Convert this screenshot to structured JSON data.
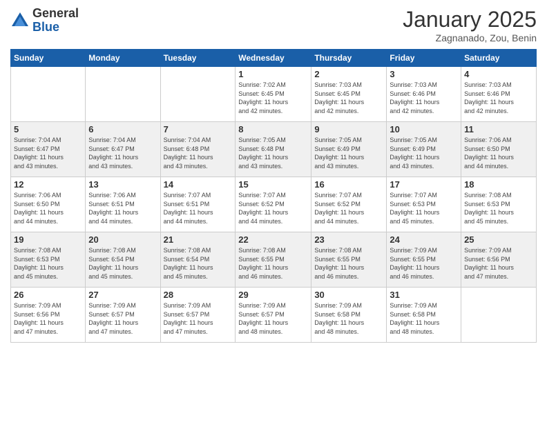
{
  "logo": {
    "general": "General",
    "blue": "Blue"
  },
  "header": {
    "title": "January 2025",
    "subtitle": "Zagnanado, Zou, Benin"
  },
  "days_of_week": [
    "Sunday",
    "Monday",
    "Tuesday",
    "Wednesday",
    "Thursday",
    "Friday",
    "Saturday"
  ],
  "weeks": [
    [
      {
        "day": "",
        "info": ""
      },
      {
        "day": "",
        "info": ""
      },
      {
        "day": "",
        "info": ""
      },
      {
        "day": "1",
        "info": "Sunrise: 7:02 AM\nSunset: 6:45 PM\nDaylight: 11 hours\nand 42 minutes."
      },
      {
        "day": "2",
        "info": "Sunrise: 7:03 AM\nSunset: 6:45 PM\nDaylight: 11 hours\nand 42 minutes."
      },
      {
        "day": "3",
        "info": "Sunrise: 7:03 AM\nSunset: 6:46 PM\nDaylight: 11 hours\nand 42 minutes."
      },
      {
        "day": "4",
        "info": "Sunrise: 7:03 AM\nSunset: 6:46 PM\nDaylight: 11 hours\nand 42 minutes."
      }
    ],
    [
      {
        "day": "5",
        "info": "Sunrise: 7:04 AM\nSunset: 6:47 PM\nDaylight: 11 hours\nand 43 minutes."
      },
      {
        "day": "6",
        "info": "Sunrise: 7:04 AM\nSunset: 6:47 PM\nDaylight: 11 hours\nand 43 minutes."
      },
      {
        "day": "7",
        "info": "Sunrise: 7:04 AM\nSunset: 6:48 PM\nDaylight: 11 hours\nand 43 minutes."
      },
      {
        "day": "8",
        "info": "Sunrise: 7:05 AM\nSunset: 6:48 PM\nDaylight: 11 hours\nand 43 minutes."
      },
      {
        "day": "9",
        "info": "Sunrise: 7:05 AM\nSunset: 6:49 PM\nDaylight: 11 hours\nand 43 minutes."
      },
      {
        "day": "10",
        "info": "Sunrise: 7:05 AM\nSunset: 6:49 PM\nDaylight: 11 hours\nand 43 minutes."
      },
      {
        "day": "11",
        "info": "Sunrise: 7:06 AM\nSunset: 6:50 PM\nDaylight: 11 hours\nand 44 minutes."
      }
    ],
    [
      {
        "day": "12",
        "info": "Sunrise: 7:06 AM\nSunset: 6:50 PM\nDaylight: 11 hours\nand 44 minutes."
      },
      {
        "day": "13",
        "info": "Sunrise: 7:06 AM\nSunset: 6:51 PM\nDaylight: 11 hours\nand 44 minutes."
      },
      {
        "day": "14",
        "info": "Sunrise: 7:07 AM\nSunset: 6:51 PM\nDaylight: 11 hours\nand 44 minutes."
      },
      {
        "day": "15",
        "info": "Sunrise: 7:07 AM\nSunset: 6:52 PM\nDaylight: 11 hours\nand 44 minutes."
      },
      {
        "day": "16",
        "info": "Sunrise: 7:07 AM\nSunset: 6:52 PM\nDaylight: 11 hours\nand 44 minutes."
      },
      {
        "day": "17",
        "info": "Sunrise: 7:07 AM\nSunset: 6:53 PM\nDaylight: 11 hours\nand 45 minutes."
      },
      {
        "day": "18",
        "info": "Sunrise: 7:08 AM\nSunset: 6:53 PM\nDaylight: 11 hours\nand 45 minutes."
      }
    ],
    [
      {
        "day": "19",
        "info": "Sunrise: 7:08 AM\nSunset: 6:53 PM\nDaylight: 11 hours\nand 45 minutes."
      },
      {
        "day": "20",
        "info": "Sunrise: 7:08 AM\nSunset: 6:54 PM\nDaylight: 11 hours\nand 45 minutes."
      },
      {
        "day": "21",
        "info": "Sunrise: 7:08 AM\nSunset: 6:54 PM\nDaylight: 11 hours\nand 45 minutes."
      },
      {
        "day": "22",
        "info": "Sunrise: 7:08 AM\nSunset: 6:55 PM\nDaylight: 11 hours\nand 46 minutes."
      },
      {
        "day": "23",
        "info": "Sunrise: 7:08 AM\nSunset: 6:55 PM\nDaylight: 11 hours\nand 46 minutes."
      },
      {
        "day": "24",
        "info": "Sunrise: 7:09 AM\nSunset: 6:55 PM\nDaylight: 11 hours\nand 46 minutes."
      },
      {
        "day": "25",
        "info": "Sunrise: 7:09 AM\nSunset: 6:56 PM\nDaylight: 11 hours\nand 47 minutes."
      }
    ],
    [
      {
        "day": "26",
        "info": "Sunrise: 7:09 AM\nSunset: 6:56 PM\nDaylight: 11 hours\nand 47 minutes."
      },
      {
        "day": "27",
        "info": "Sunrise: 7:09 AM\nSunset: 6:57 PM\nDaylight: 11 hours\nand 47 minutes."
      },
      {
        "day": "28",
        "info": "Sunrise: 7:09 AM\nSunset: 6:57 PM\nDaylight: 11 hours\nand 47 minutes."
      },
      {
        "day": "29",
        "info": "Sunrise: 7:09 AM\nSunset: 6:57 PM\nDaylight: 11 hours\nand 48 minutes."
      },
      {
        "day": "30",
        "info": "Sunrise: 7:09 AM\nSunset: 6:58 PM\nDaylight: 11 hours\nand 48 minutes."
      },
      {
        "day": "31",
        "info": "Sunrise: 7:09 AM\nSunset: 6:58 PM\nDaylight: 11 hours\nand 48 minutes."
      },
      {
        "day": "",
        "info": ""
      }
    ]
  ]
}
